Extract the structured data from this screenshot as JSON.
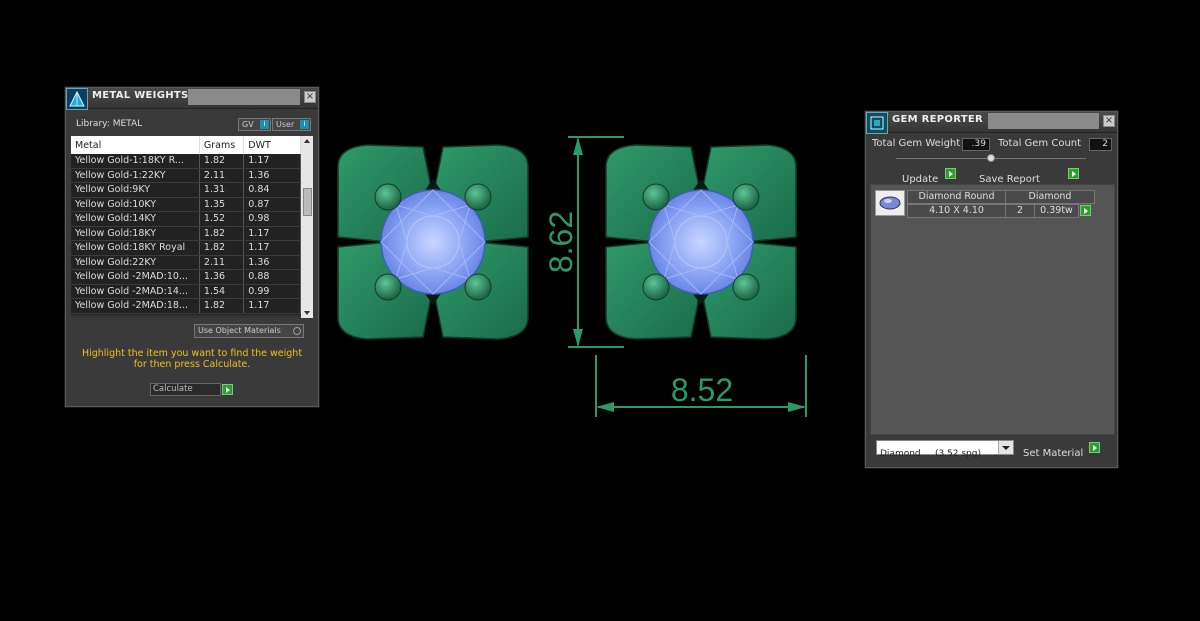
{
  "metal_panel": {
    "title": "METAL WEIGHTS",
    "library_label": "Library: METAL",
    "gv_label": "GV",
    "user_label": "User",
    "columns": [
      "Metal",
      "Grams",
      "DWT"
    ],
    "rows": [
      {
        "metal": "Yellow Gold-1:18KY R...",
        "grams": "1.82",
        "dwt": "1.17"
      },
      {
        "metal": "Yellow Gold-1:22KY",
        "grams": "2.11",
        "dwt": "1.36"
      },
      {
        "metal": "Yellow Gold:9KY",
        "grams": "1.31",
        "dwt": "0.84"
      },
      {
        "metal": "Yellow Gold:10KY",
        "grams": "1.35",
        "dwt": "0.87"
      },
      {
        "metal": "Yellow Gold:14KY",
        "grams": "1.52",
        "dwt": "0.98"
      },
      {
        "metal": "Yellow Gold:18KY",
        "grams": "1.82",
        "dwt": "1.17"
      },
      {
        "metal": "Yellow Gold:18KY Royal",
        "grams": "1.82",
        "dwt": "1.17"
      },
      {
        "metal": "Yellow Gold:22KY",
        "grams": "2.11",
        "dwt": "1.36"
      },
      {
        "metal": "Yellow Gold -2MAD:10...",
        "grams": "1.36",
        "dwt": "0.88"
      },
      {
        "metal": "Yellow Gold -2MAD:14...",
        "grams": "1.54",
        "dwt": "0.99"
      },
      {
        "metal": "Yellow Gold -2MAD:18...",
        "grams": "1.82",
        "dwt": "1.17"
      }
    ],
    "use_object_materials": "Use Object Materials",
    "instruction": "Highlight the item you want to find the weight for then press Calculate.",
    "calculate_label": "Calculate"
  },
  "viewport": {
    "dim_height": "8.62",
    "dim_width": "8.52",
    "colors": {
      "metal": "#1f7a52",
      "stone": "#7f9cf5",
      "dimension": "#2a9a66"
    }
  },
  "gem_panel": {
    "title": "GEM REPORTER",
    "total_weight_label": "Total Gem Weight",
    "total_weight_value": ".39",
    "total_count_label": "Total Gem Count",
    "total_count_value": "2",
    "update_label": "Update",
    "save_report_label": "Save Report",
    "gem_row": {
      "shape_header": "Diamond Round",
      "material_header": "Diamond",
      "size": "4.10 X 4.10",
      "count": "2",
      "weight": "0.39tw"
    },
    "material_select": "Diamond     (3.52 spg)",
    "set_material_label": "Set Material"
  }
}
